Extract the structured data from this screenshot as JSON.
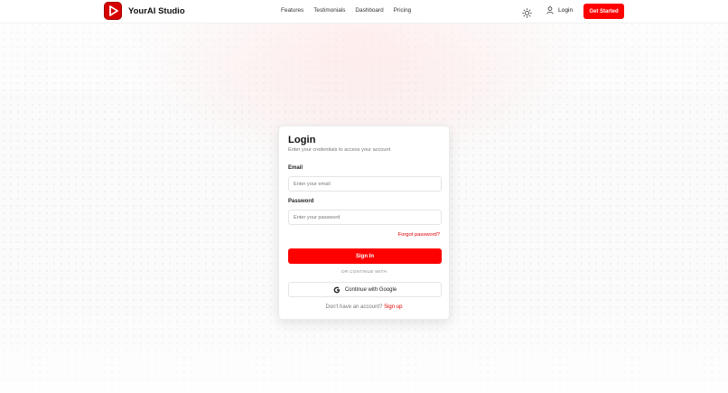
{
  "header": {
    "brand_name": "YourAI Studio",
    "nav": [
      "Features",
      "Testimonials",
      "Dashboard",
      "Pricing"
    ],
    "login_label": "Login",
    "cta_label": "Get Started"
  },
  "login_card": {
    "title": "Login",
    "subtitle": "Enter your credentials to access your account",
    "email_label": "Email",
    "email_placeholder": "Enter your email",
    "email_value": "",
    "password_label": "Password",
    "password_placeholder": "Enter your password",
    "password_value": "",
    "forgot_label": "Forgot password?",
    "signin_label": "Sign In",
    "divider_text": "OR CONTINUE WITH",
    "google_label": "Continue with Google",
    "signup_prompt": "Don't have an account?",
    "signup_label": "Sign up"
  },
  "icons": {
    "logo": "play-logo-icon",
    "theme": "sun-icon",
    "login": "user-icon",
    "google": "google-icon"
  },
  "colors": {
    "accent": "#ff0000",
    "link": "#e00000",
    "logo_bg": "#d60000"
  }
}
